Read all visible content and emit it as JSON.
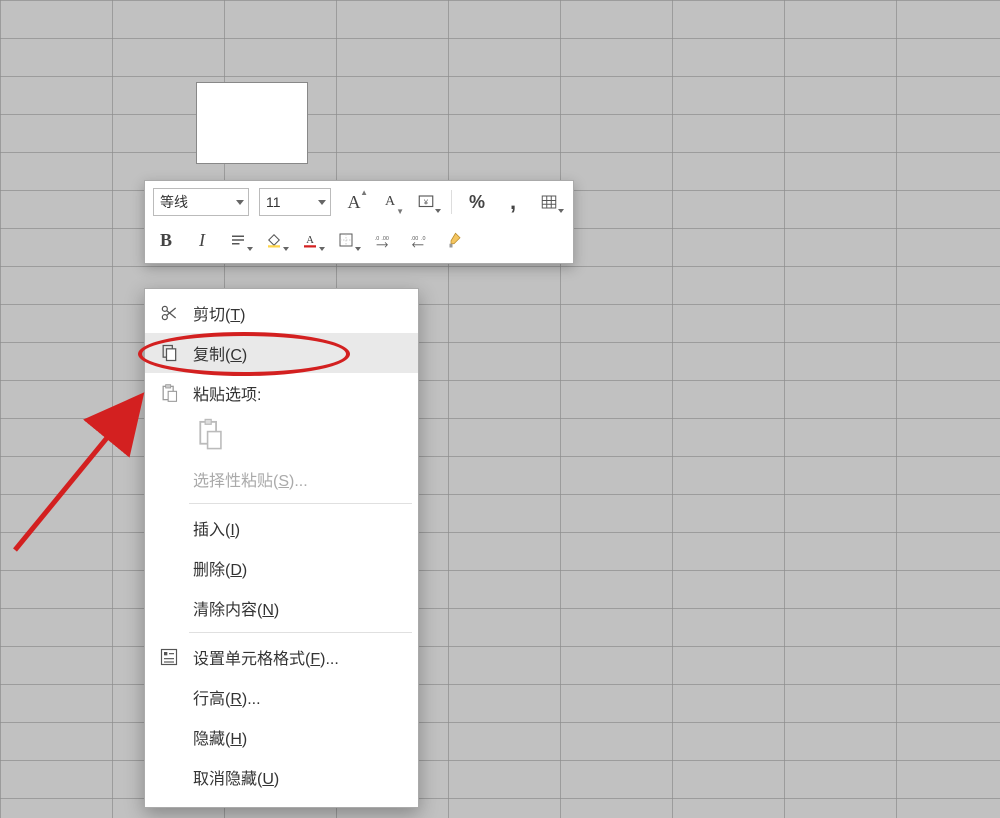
{
  "mini_toolbar": {
    "font_name": "等线",
    "font_size": "11",
    "btn_increase_font": "A",
    "btn_decrease_font": "A",
    "btn_bold": "B",
    "btn_italic": "I"
  },
  "context_menu": {
    "cut": {
      "label": "剪切",
      "key": "T"
    },
    "copy": {
      "label": "复制",
      "key": "C"
    },
    "paste_options_header": "粘贴选项:",
    "paste_special": {
      "label": "选择性粘贴",
      "key": "S",
      "suffix": "..."
    },
    "insert": {
      "label": "插入",
      "key": "I"
    },
    "delete": {
      "label": "删除",
      "key": "D"
    },
    "clear": {
      "label": "清除内容",
      "key": "N"
    },
    "format_cells": {
      "label": "设置单元格格式",
      "key": "F",
      "suffix": "..."
    },
    "row_height": {
      "label": "行高",
      "key": "R",
      "suffix": "..."
    },
    "hide": {
      "label": "隐藏",
      "key": "H"
    },
    "unhide": {
      "label": "取消隐藏",
      "key": "U"
    }
  },
  "colors": {
    "annotation_red": "#d32020",
    "font_color_underline": "#d32020",
    "fill_color_underline": "#ffd54a"
  }
}
